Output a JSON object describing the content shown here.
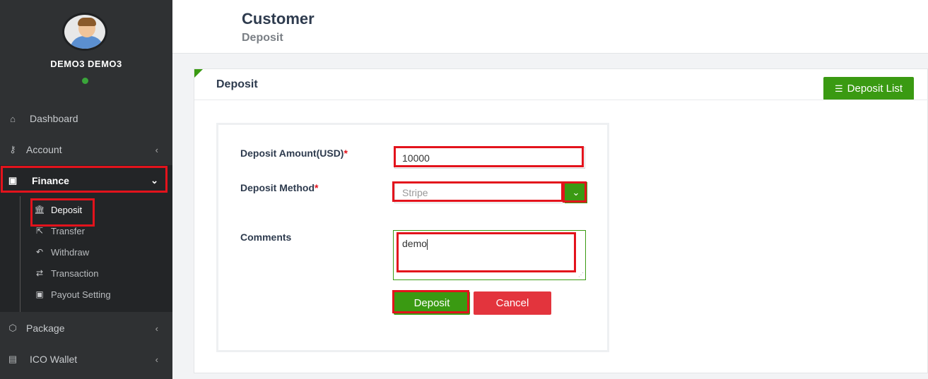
{
  "user": {
    "name": "DEMO3 DEMO3",
    "status": "online"
  },
  "sidebar": {
    "items": [
      {
        "label": "Dashboard",
        "icon": "home-icon"
      },
      {
        "label": "Account",
        "icon": "key-icon"
      },
      {
        "label": "Finance",
        "icon": "money-icon"
      },
      {
        "label": "Package",
        "icon": "box-icon"
      },
      {
        "label": "ICO Wallet",
        "icon": "id-card-icon"
      }
    ],
    "finance_sub": [
      {
        "label": "Deposit",
        "icon": "bank-icon"
      },
      {
        "label": "Transfer",
        "icon": "share-icon"
      },
      {
        "label": "Withdraw",
        "icon": "reply-icon"
      },
      {
        "label": "Transaction",
        "icon": "exchange-icon"
      },
      {
        "label": "Payout Setting",
        "icon": "money-icon"
      }
    ]
  },
  "header": {
    "title": "Customer",
    "subtitle": "Deposit"
  },
  "card": {
    "title": "Deposit",
    "list_button": "Deposit List"
  },
  "form": {
    "amount_label": "Deposit Amount(USD)",
    "amount_value": "10000",
    "method_label": "Deposit Method",
    "method_value": "Stripe",
    "comments_label": "Comments",
    "comments_value": "demo",
    "required_mark": "*",
    "submit_label": "Deposit",
    "cancel_label": "Cancel"
  },
  "colors": {
    "accent": "#3a9a12",
    "danger": "#e3343d",
    "highlight": "#e3131c",
    "sidebar": "#2f3133"
  }
}
